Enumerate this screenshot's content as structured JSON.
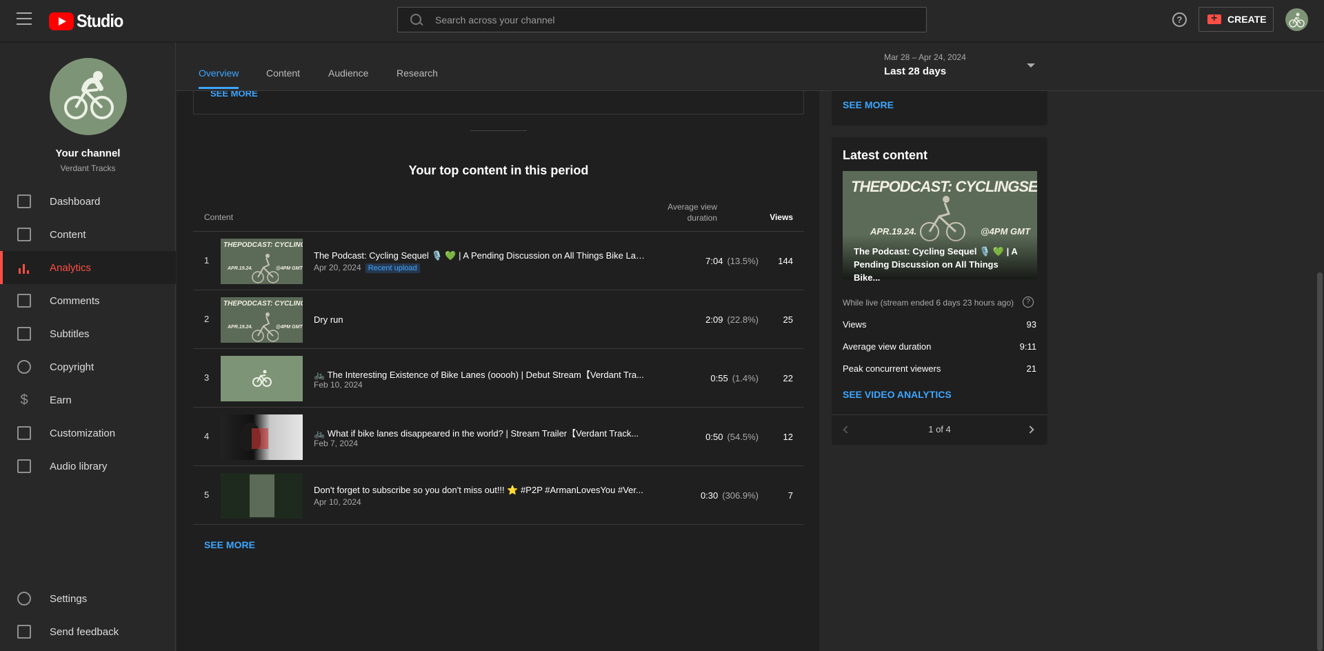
{
  "app": {
    "logo_text": "Studio"
  },
  "search": {
    "placeholder": "Search across your channel"
  },
  "header": {
    "create_label": "CREATE",
    "help_glyph": "?"
  },
  "channel": {
    "name": "Your channel",
    "handle": "Verdant Tracks"
  },
  "sidebar": {
    "items": [
      {
        "label": "Dashboard",
        "icon": "dashboard-icon"
      },
      {
        "label": "Content",
        "icon": "content-icon"
      },
      {
        "label": "Analytics",
        "icon": "analytics-icon",
        "active": true
      },
      {
        "label": "Comments",
        "icon": "comments-icon"
      },
      {
        "label": "Subtitles",
        "icon": "subtitles-icon"
      },
      {
        "label": "Copyright",
        "icon": "copyright-icon"
      },
      {
        "label": "Earn",
        "icon": "earn-icon"
      },
      {
        "label": "Customization",
        "icon": "customization-icon"
      },
      {
        "label": "Audio library",
        "icon": "audio-library-icon"
      }
    ],
    "settings_label": "Settings",
    "feedback_label": "Send feedback"
  },
  "tabs": [
    "Overview",
    "Content",
    "Audience",
    "Research"
  ],
  "date_range": {
    "range": "Mar 28 – Apr 24, 2024",
    "label": "Last 28 days"
  },
  "main": {
    "prev_see_more": "SEE MORE",
    "section_title": "Your top content in this period",
    "col_content": "Content",
    "col_avd": "Average view duration",
    "col_views": "Views",
    "rows": [
      {
        "rank": "1",
        "title": "The Podcast: Cycling Sequel 🎙️ 💚 | A Pending Discussion on All Things Bike Lan...",
        "date": "Apr 20, 2024",
        "badge": "Recent upload",
        "duration": "7:04",
        "pct": "(13.5%)",
        "views": "144"
      },
      {
        "rank": "2",
        "title": "Dry run",
        "date": "",
        "badge": "",
        "duration": "2:09",
        "pct": "(22.8%)",
        "views": "25"
      },
      {
        "rank": "3",
        "title": "🚲 The Interesting Existence of Bike Lanes (ooooh) | Debut Stream【Verdant Tra...",
        "date": "Feb 10, 2024",
        "badge": "",
        "duration": "0:55",
        "pct": "(1.4%)",
        "views": "22"
      },
      {
        "rank": "4",
        "title": "🚲 What if bike lanes disappeared in the world? | Stream Trailer【Verdant Track...",
        "date": "Feb 7, 2024",
        "badge": "",
        "duration": "0:50",
        "pct": "(54.5%)",
        "views": "12"
      },
      {
        "rank": "5",
        "title": "Don't forget to subscribe so you don't miss out!!! ⭐ #P2P #ArmanLovesYou #Ver...",
        "date": "Apr 10, 2024",
        "badge": "",
        "duration": "0:30",
        "pct": "(306.9%)",
        "views": "7"
      }
    ],
    "see_more": "SEE MORE"
  },
  "right": {
    "top_see_more": "SEE MORE",
    "latest_heading": "Latest content",
    "thumb_text_top": "THEPODCAST: CYCLINGSEQUEL",
    "thumb_date": "APR.19.24.",
    "thumb_time": "@4PM GMT",
    "latest_title": "The Podcast: Cycling Sequel 🎙️ 💚 | A Pending Discussion on All Things Bike...",
    "while_live": "While live (stream ended 6 days 23 hours ago)",
    "stats": [
      {
        "label": "Views",
        "value": "93"
      },
      {
        "label": "Average view duration",
        "value": "9:11"
      },
      {
        "label": "Peak concurrent viewers",
        "value": "21"
      }
    ],
    "see_video_analytics": "SEE VIDEO ANALYTICS",
    "pager": "1 of 4"
  },
  "colors": {
    "accent_blue": "#3ea6ff",
    "active_red": "#ff4e45",
    "brand_red": "#ff0000",
    "avatar_green": "#7e9477"
  }
}
